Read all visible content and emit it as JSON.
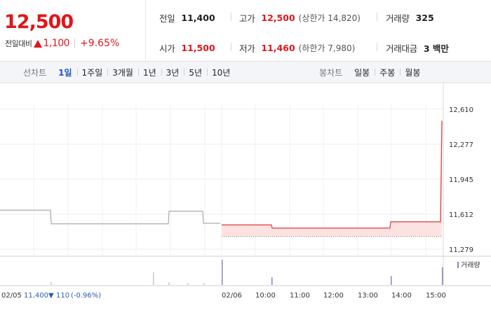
{
  "quote": {
    "price": "12,500",
    "change_label": "전일대비",
    "change_value": "1,100",
    "change_pct": "+9.65%",
    "up_color": "#e0161b"
  },
  "stats": {
    "prev": {
      "label": "전일",
      "value": "11,400"
    },
    "high": {
      "label": "고가",
      "value": "12,500",
      "sub": "(상한가 14,820)"
    },
    "volume": {
      "label": "거래량",
      "value": "325"
    },
    "open": {
      "label": "시가",
      "value": "11,500"
    },
    "low": {
      "label": "저가",
      "value": "11,460",
      "sub": "(하한가 7,980)"
    },
    "amount": {
      "label": "거래대금",
      "value": "3 백만"
    }
  },
  "tabs": {
    "line_title": "선차트",
    "line": [
      "1일",
      "1주일",
      "3개월",
      "1년",
      "3년",
      "5년",
      "10년"
    ],
    "active_line_index": 0,
    "candle_title": "봉차트",
    "candle": [
      "일봉",
      "주봉",
      "월봉"
    ]
  },
  "chart_data": {
    "type": "line",
    "y_ticks": [
      "12,610",
      "12,277",
      "11,945",
      "11,612",
      "11,279"
    ],
    "ylim": [
      11279,
      12610
    ],
    "prev_close": 11400,
    "x_ticks": [
      "02/05",
      "02/06",
      "10:00",
      "11:00",
      "12:00",
      "13:00",
      "14:00",
      "15:00"
    ],
    "prev_day_series": {
      "x": [
        0,
        72,
        73,
        240,
        241,
        289,
        290,
        314
      ],
      "y": [
        11650,
        11650,
        11520,
        11520,
        11640,
        11640,
        11525,
        11525
      ]
    },
    "today_series": {
      "x": [
        316,
        387,
        388,
        556,
        557,
        628,
        630
      ],
      "y": [
        11510,
        11510,
        11480,
        11480,
        11540,
        11540,
        12500
      ]
    },
    "volume_legend": "거래량",
    "volume_bars": [
      {
        "x": 72,
        "v": 0.12
      },
      {
        "x": 218,
        "v": 0.5
      },
      {
        "x": 240,
        "v": 0.1
      },
      {
        "x": 267,
        "v": 0.08
      },
      {
        "x": 290,
        "v": 0.08
      },
      {
        "x": 316,
        "v": 1.0
      },
      {
        "x": 387,
        "v": 0.3
      },
      {
        "x": 557,
        "v": 0.35
      },
      {
        "x": 630,
        "v": 0.7
      }
    ],
    "footer": {
      "date": "02/05",
      "price": "11,400",
      "arrow": "▼",
      "diff": "110",
      "pct": "(-0.96%)"
    },
    "colors": {
      "prev_line": "#aaaaaa",
      "today_line": "#e24a4a",
      "today_fill": "#fde2e2",
      "prev_volume": "#c8c8c8",
      "today_volume": "#8a83c9",
      "footer_blue": "#2a5db0"
    }
  }
}
